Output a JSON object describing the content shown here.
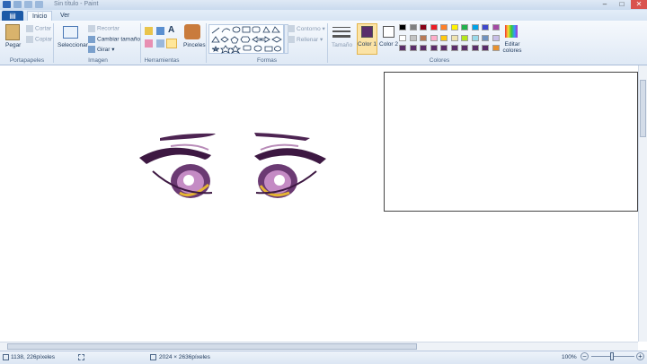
{
  "window": {
    "title": "Sin título - Paint"
  },
  "tabs": {
    "file": "▤",
    "home": "Inicio",
    "view": "Ver"
  },
  "groups": {
    "clipboard": {
      "label": "Portapapeles",
      "paste": "Pegar",
      "cut": "Cortar",
      "copy": "Copiar"
    },
    "image": {
      "label": "Imagen",
      "select": "Seleccionar",
      "crop": "Recortar",
      "resize": "Cambiar tamaño",
      "rotate": "Girar"
    },
    "tools": {
      "label": "Herramientas"
    },
    "brushes": {
      "label": "Pinceles"
    },
    "shapes": {
      "label": "Formas",
      "outline": "Contorno",
      "fill": "Rellenar"
    },
    "size": {
      "label": "Tamaño"
    },
    "colors": {
      "label": "Colores",
      "color1": "Color 1",
      "color2": "Color 2",
      "edit": "Editar colores",
      "color1_value": "#5a2d6b",
      "palette": [
        "#000000",
        "#7f7f7f",
        "#880015",
        "#ed1c24",
        "#ff7f27",
        "#fff200",
        "#22b14c",
        "#00a2e8",
        "#3f48cc",
        "#a349a4",
        "#ffffff",
        "#c3c3c3",
        "#b97a57",
        "#ffaec9",
        "#ffc90e",
        "#efe4b0",
        "#b5e61d",
        "#99d9ea",
        "#7092be",
        "#c8bfe7",
        "#5a2d6b",
        "#5a2d6b",
        "#5a2d6b",
        "#5a2d6b",
        "#5a2d6b",
        "#5a2d6b",
        "#5a2d6b",
        "#5a2d6b",
        "#5a2d6b",
        "#e8912d"
      ]
    }
  },
  "status": {
    "cursor": "1138, 226píxeles",
    "size": "2024 × 2636píxeles",
    "zoom": "100%"
  }
}
